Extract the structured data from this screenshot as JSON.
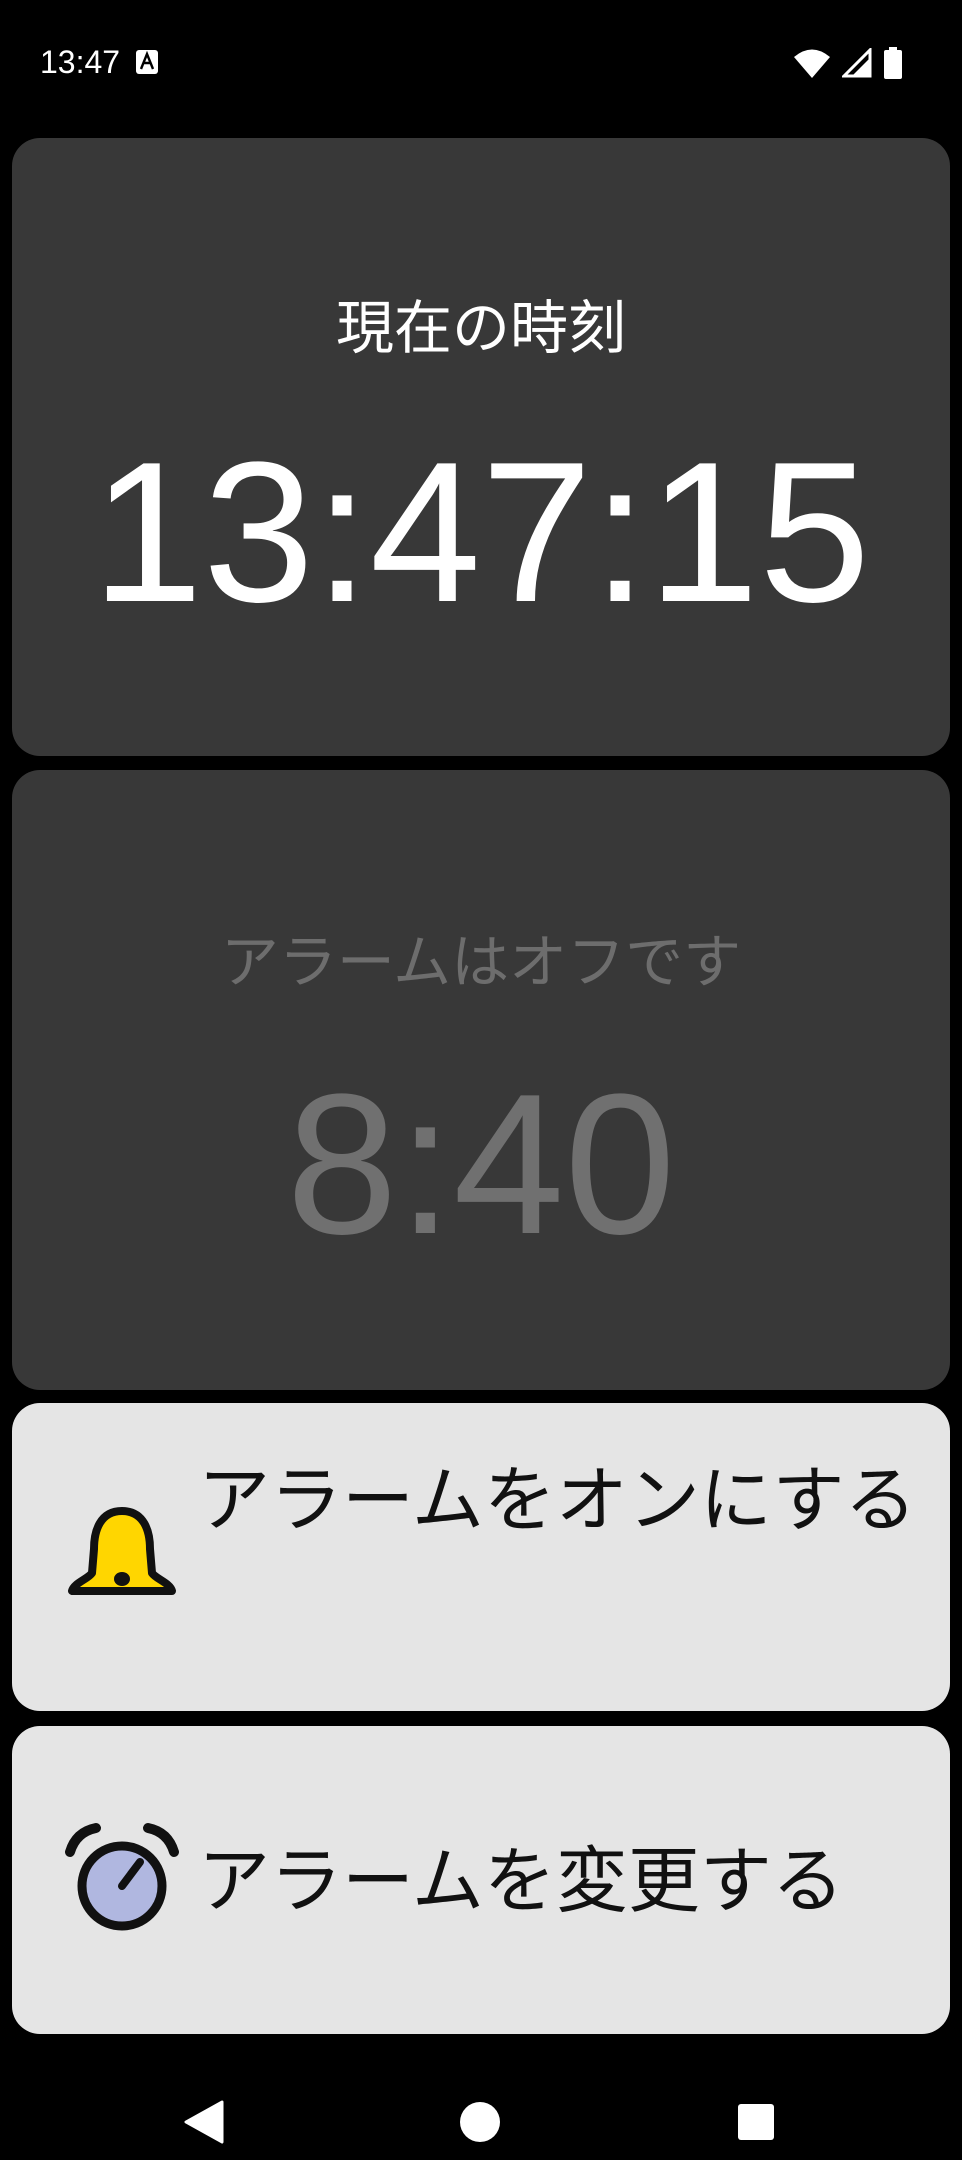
{
  "status_bar": {
    "time": "13:47",
    "icons": [
      "text-a-icon",
      "wifi-icon",
      "signal-icon",
      "battery-icon"
    ]
  },
  "clock": {
    "label": "現在の時刻",
    "time": "13:47:15"
  },
  "alarm": {
    "status_label": "アラームはオフです",
    "time": "8:40"
  },
  "actions": {
    "toggle_label": "アラームをオンにする",
    "toggle_icon": "bell-icon",
    "change_label": "アラームを変更する",
    "change_icon": "alarm-clock-icon"
  },
  "nav_bar": {
    "icons": [
      "back-icon",
      "home-icon",
      "recents-icon"
    ]
  },
  "colors": {
    "card_dark": "#383838",
    "card_light": "#e5e5e5",
    "bell_fill": "#ffd600",
    "clock_face": "#b0b7e0"
  }
}
